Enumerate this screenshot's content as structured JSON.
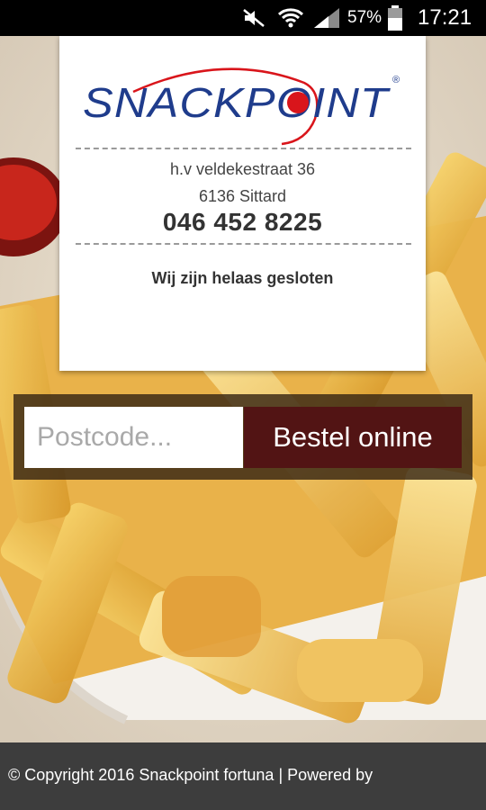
{
  "status_bar": {
    "battery_percent": "57%",
    "time": "17:21",
    "icons": [
      "mute-icon",
      "wifi-icon",
      "signal-icon",
      "battery-icon"
    ]
  },
  "brand": {
    "logo_text": "SNACKPOINT",
    "logo_colors": {
      "text": "#1f3c8c",
      "dot": "#d9151b"
    }
  },
  "receipt": {
    "address_line1": "h.v veldekestraat 36",
    "address_line2": "6136 Sittard",
    "phone": "046 452 8225",
    "status": "Wij zijn helaas gesloten"
  },
  "order": {
    "postcode_placeholder": "Postcode...",
    "postcode_value": "",
    "button_label": "Bestel online"
  },
  "footer": {
    "text": "© Copyright 2016 Snackpoint fortuna | Powered by"
  },
  "colors": {
    "button_bg": "#521414",
    "frame_bg": "#37261a",
    "footer_bg": "#3d3d3d"
  }
}
